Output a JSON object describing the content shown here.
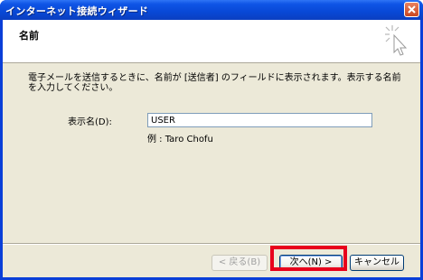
{
  "window": {
    "title": "インターネット接続ウィザード"
  },
  "header": {
    "title": "名前"
  },
  "content": {
    "description": "電子メールを送信するときに、名前が [送信者] のフィールドに表示されます。表示する名前を入力してください。",
    "display_name_label": "表示名(D):",
    "display_name_value": "USER",
    "example_text": "例 : Taro Chofu"
  },
  "buttons": {
    "back_label": "< 戻る(B)",
    "next_label": "次へ(N) >",
    "cancel_label": "キャンセル"
  },
  "colors": {
    "highlight": "#e8001c",
    "titlebar": "#0848d6"
  }
}
